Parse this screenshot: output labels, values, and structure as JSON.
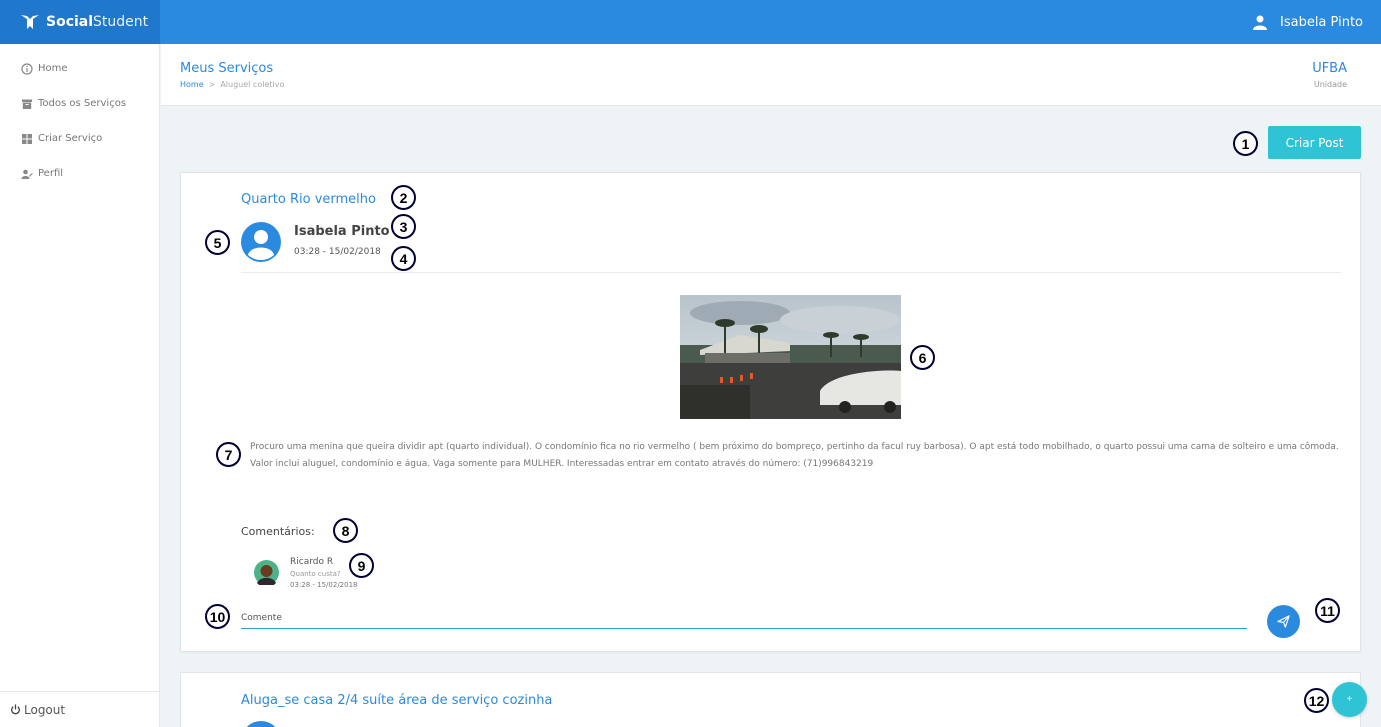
{
  "brand": {
    "name_bold": "Social",
    "name_light": "Student"
  },
  "user": {
    "name": "Isabela Pinto"
  },
  "sidebar": {
    "items": [
      {
        "label": "Home",
        "icon": "info-circle-icon"
      },
      {
        "label": "Todos os Serviços",
        "icon": "archive-icon"
      },
      {
        "label": "Criar Serviço",
        "icon": "grid-icon"
      },
      {
        "label": "Perfil",
        "icon": "user-edit-icon"
      }
    ],
    "logout": "Logout"
  },
  "header": {
    "title": "Meus Serviços",
    "breadcrumb": {
      "home": "Home",
      "sep": ">",
      "current": "Aluguel coletivo"
    },
    "unit_name": "UFBA",
    "unit_label": "Unidade"
  },
  "actions": {
    "create_post": "Criar Post",
    "fab": "+"
  },
  "post": {
    "title": "Quarto Rio vermelho",
    "author": "Isabela Pinto",
    "datetime": "03:28 - 15/02/2018",
    "description": "Procuro uma menina que queira dividir apt (quarto individual). O condomínio fica no rio vermelho ( bem próximo do bompreço, pertinho da facul ruy barbosa). O apt está todo mobilhado, o quarto possui uma cama de solteiro e uma cômoda. Valor inclui aluguel, condomínio e água. Vaga somente para MULHER. Interessadas entrar em contato através do número: (71)996843219",
    "comments_label": "Comentários:",
    "comments": [
      {
        "name": "Ricardo R",
        "text": "Quanto custa?",
        "datetime": "03:28 - 15/02/2018"
      }
    ],
    "comment_placeholder": "Comente"
  },
  "post2": {
    "title": "Aluga_se casa 2/4 suíte área de serviço cozinha"
  },
  "markers": [
    "1",
    "2",
    "3",
    "4",
    "5",
    "6",
    "7",
    "8",
    "9",
    "10",
    "11",
    "12"
  ],
  "colors": {
    "primary": "#2a8ae0",
    "accent": "#2ec4d6",
    "background": "#eef3f6"
  }
}
